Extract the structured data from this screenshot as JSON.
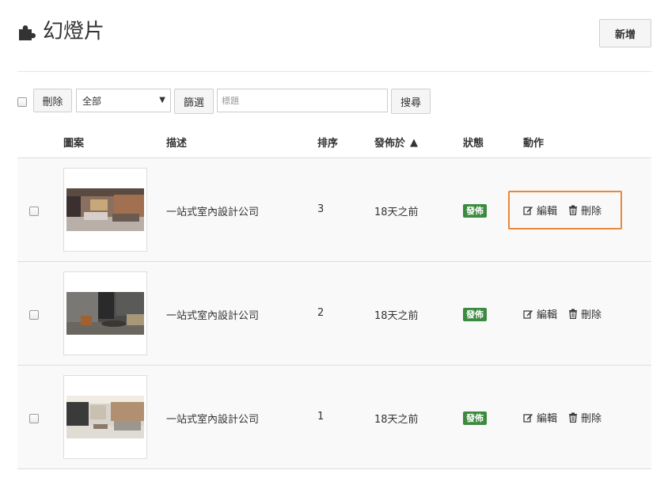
{
  "header": {
    "title": "幻燈片",
    "add_label": "新增"
  },
  "toolbar": {
    "delete_label": "刪除",
    "select_value": "全部",
    "filter_label": "篩選",
    "search_placeholder": "標題",
    "search_label": "搜尋"
  },
  "table": {
    "columns": {
      "image": "圖案",
      "desc": "描述",
      "order": "排序",
      "published": "發佈於",
      "status": "狀態",
      "actions": "動作"
    },
    "rows": [
      {
        "desc": "一站式室內設計公司",
        "order": "3",
        "published": "18天之前",
        "status": "發佈",
        "edit": "編輯",
        "delete": "刪除"
      },
      {
        "desc": "一站式室內設計公司",
        "order": "2",
        "published": "18天之前",
        "status": "發佈",
        "edit": "編輯",
        "delete": "刪除"
      },
      {
        "desc": "一站式室內設計公司",
        "order": "1",
        "published": "18天之前",
        "status": "發佈",
        "edit": "編輯",
        "delete": "刪除"
      }
    ]
  },
  "icons": {
    "title": "puzzle-icon",
    "edit": "edit-icon",
    "delete": "trash-icon",
    "sort": "sort-up-icon"
  },
  "colors": {
    "status_badge": "#3c8a3f",
    "highlight": "#e8883a"
  }
}
